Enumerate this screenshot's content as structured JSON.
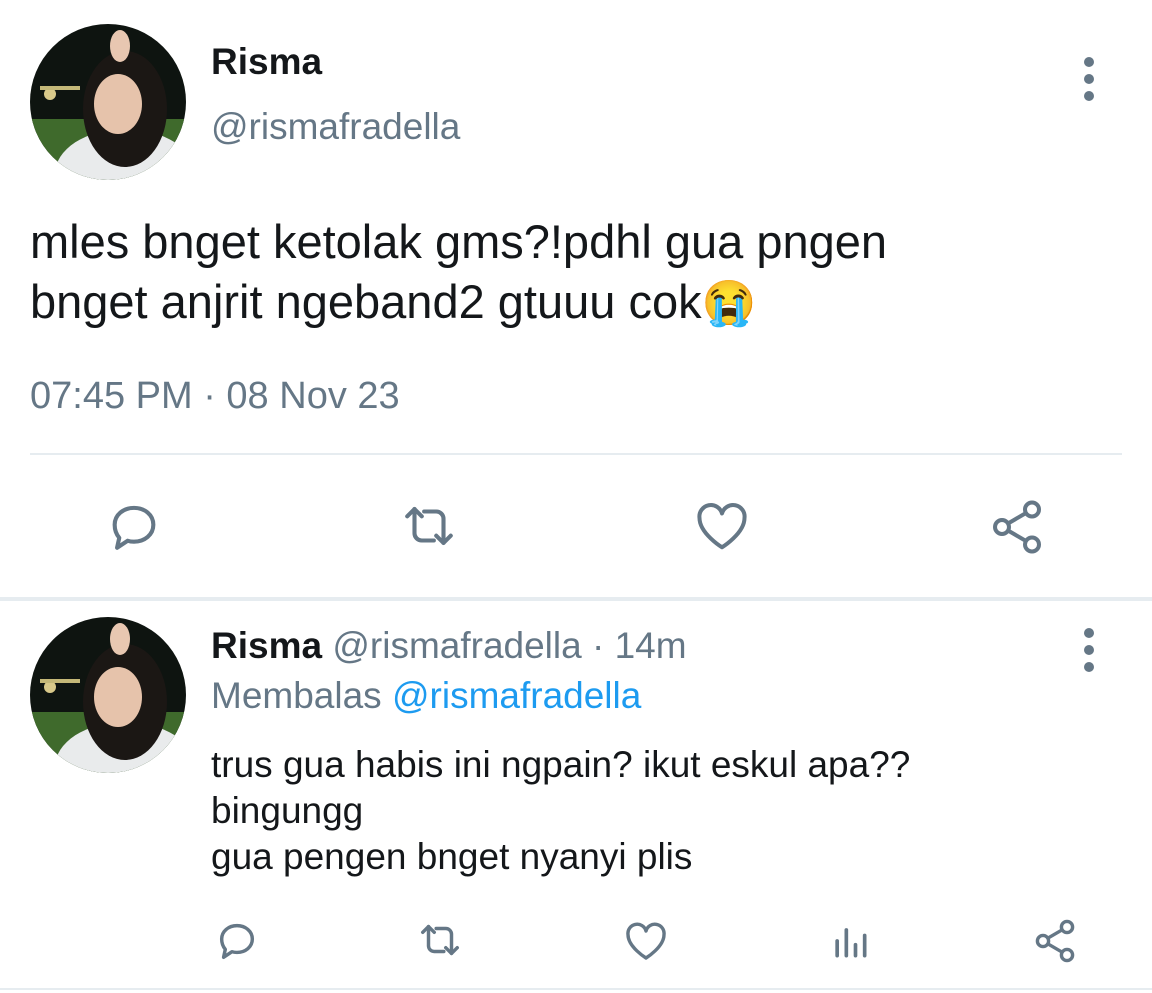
{
  "main_tweet": {
    "author_name": "Risma",
    "handle": "@rismafradella",
    "text_line1": "mles bnget ketolak gms?!pdhl gua pngen",
    "text_line2": "bnget anjrit ngeband2 gtuuu cok",
    "emoji": "😭",
    "timestamp": "07:45 PM · 08 Nov 23",
    "actions": [
      "reply-icon",
      "retweet-icon",
      "like-icon",
      "share-icon"
    ]
  },
  "reply_tweet": {
    "author_name": "Risma",
    "handle_time": "@rismafradella · 14m",
    "replying_prefix": "Membalas",
    "replying_to": "@rismafradella",
    "text_line1": "trus gua habis ini ngpain? ikut eskul apa??",
    "text_line2": "bingungg",
    "text_line3": "gua pengen bnget nyanyi plis",
    "actions": [
      "reply-icon",
      "retweet-icon",
      "like-icon",
      "analytics-icon",
      "share-icon"
    ]
  },
  "colors": {
    "text": "#14171a",
    "muted": "#657786",
    "link": "#1d9bf0",
    "divider": "#e6ecf0"
  }
}
